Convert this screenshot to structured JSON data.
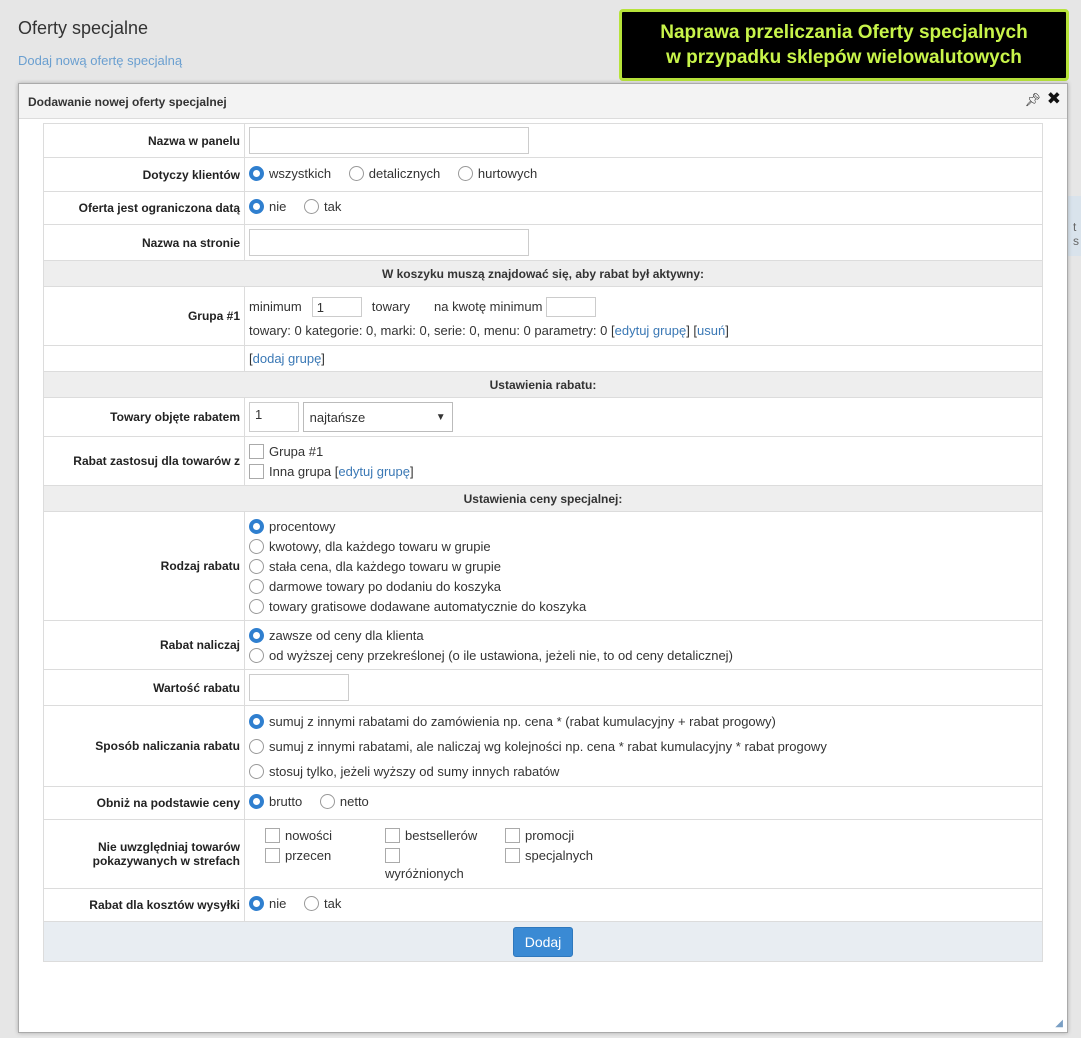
{
  "page": {
    "title": "Oferty specjalne",
    "add_link": "Dodaj nową ofertę specjalną"
  },
  "banner": {
    "line1": "Naprawa przeliczania Oferty specjalnych",
    "line2": "w przypadku sklepów wielowalutowych",
    "bg_color": "#000000",
    "text_color": "#c8f44a"
  },
  "background_fragment": "t s",
  "dialog": {
    "title": "Dodawanie nowej oferty specjalnej",
    "icons": [
      "pin-icon",
      "close-icon",
      "resize-icon"
    ],
    "rows": {
      "panel_name": {
        "label": "Nazwa w panelu",
        "value": ""
      },
      "customers": {
        "label": "Dotyczy klientów",
        "options": [
          "wszystkich",
          "detalicznych",
          "hurtowych"
        ],
        "selected": "wszystkich"
      },
      "date_limited": {
        "label": "Oferta jest ograniczona datą",
        "options": [
          "nie",
          "tak"
        ],
        "selected": "nie"
      },
      "site_name": {
        "label": "Nazwa na stronie",
        "value": ""
      },
      "basket_section": "W koszyku muszą znajdować się, aby rabat był aktywny:",
      "group1": {
        "label": "Grupa #1",
        "min_label": "minimum",
        "min_value": "1",
        "unit": "towary",
        "amount_label": "na kwotę minimum",
        "amount_value": "",
        "summary": "towary: 0 kategorie: 0, marki: 0, serie: 0, menu: 0 parametry: 0",
        "edit_link": "edytuj grupę",
        "remove_link": "usuń"
      },
      "add_group_link": "dodaj grupę",
      "discount_section": "Ustawienia rabatu:",
      "covered_items": {
        "label": "Towary objęte rabatem",
        "count": "1",
        "select_value": "najtańsze"
      },
      "apply_for": {
        "label": "Rabat zastosuj dla towarów z",
        "opt1": "Grupa #1",
        "opt2": "Inna grupa",
        "edit_link": "edytuj grupę"
      },
      "price_section": "Ustawienia ceny specjalnej:",
      "discount_type": {
        "label": "Rodzaj rabatu",
        "options": [
          "procentowy",
          "kwotowy, dla każdego towaru w grupie",
          "stała cena, dla każdego towaru w grupie",
          "darmowe towary po dodaniu do koszyka",
          "towary gratisowe dodawane automatycznie do koszyka"
        ],
        "selected": "procentowy"
      },
      "calc_from": {
        "label": "Rabat naliczaj",
        "options": [
          "zawsze od ceny dla klienta",
          "od wyższej ceny przekreślonej (o ile ustawiona, jeżeli nie, to od ceny detalicznej)"
        ],
        "selected": "zawsze od ceny dla klienta"
      },
      "discount_value": {
        "label": "Wartość rabatu",
        "value": ""
      },
      "calc_method": {
        "label": "Sposób naliczania rabatu",
        "options": [
          "sumuj z innymi rabatami do zamówienia np. cena * (rabat kumulacyjny + rabat progowy)",
          "sumuj z innymi rabatami, ale naliczaj wg kolejności np. cena * rabat kumulacyjny * rabat progowy",
          "stosuj tylko, jeżeli wyższy od sumy innych rabatów"
        ],
        "selected": "sumuj z innymi rabatami do zamówienia np. cena * (rabat kumulacyjny + rabat progowy)"
      },
      "price_basis": {
        "label": "Obniż na podstawie ceny",
        "options": [
          "brutto",
          "netto"
        ],
        "selected": "brutto"
      },
      "exclude_zones": {
        "label_line1": "Nie uwzględniaj towarów",
        "label_line2": "pokazywanych w strefach",
        "options": [
          "nowości",
          "bestsellerów",
          "promocji",
          "przecen",
          "wyróżnionych",
          "specjalnych"
        ]
      },
      "shipping_discount": {
        "label": "Rabat dla kosztów wysyłki",
        "options": [
          "nie",
          "tak"
        ],
        "selected": "nie"
      }
    },
    "submit_label": "Dodaj"
  }
}
